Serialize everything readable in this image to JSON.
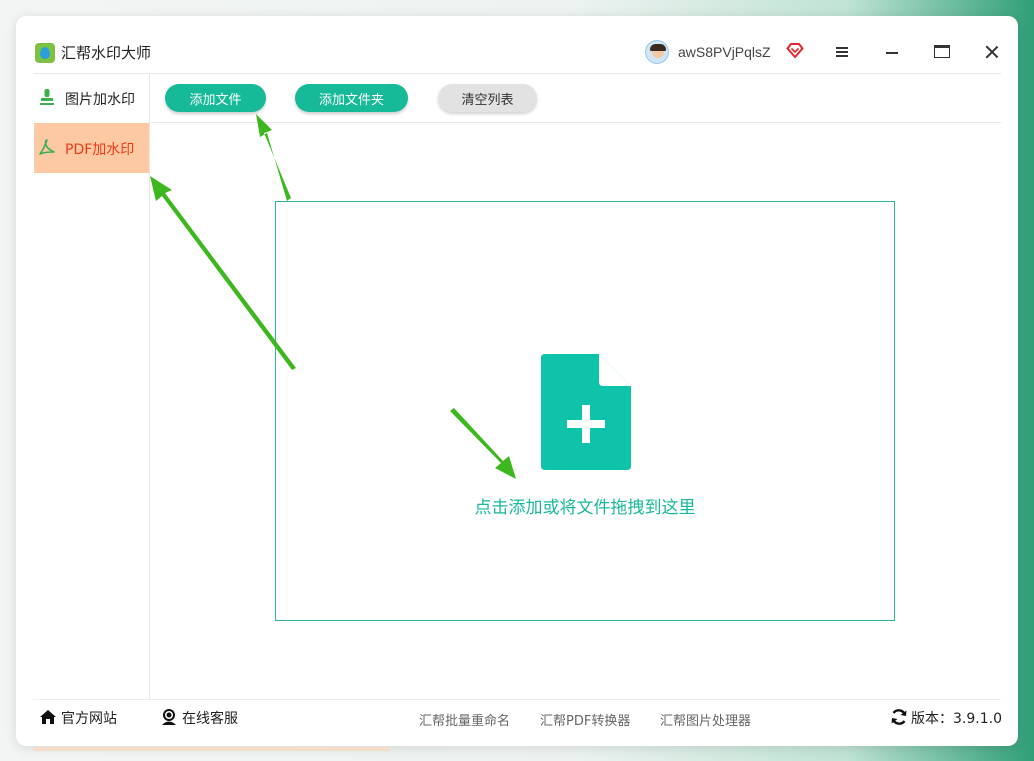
{
  "app": {
    "title": "汇帮水印大师"
  },
  "user": {
    "name": "awS8PVjPqlsZ"
  },
  "window_controls": {
    "menu": "menu-icon",
    "minimize": "minimize-icon",
    "maximize": "maximize-icon",
    "close": "close-icon"
  },
  "sidebar": {
    "items": [
      {
        "label": "图片加水印",
        "icon": "image-stamp-icon",
        "active": false
      },
      {
        "label": "PDF加水印",
        "icon": "pdf-icon",
        "active": true
      }
    ]
  },
  "toolbar": {
    "add_file": "添加文件",
    "add_folder": "添加文件夹",
    "clear_list": "清空列表"
  },
  "dropzone": {
    "hint": "点击添加或将文件拖拽到这里",
    "icon": "file-plus-icon"
  },
  "footer": {
    "website": "官方网站",
    "support": "在线客服",
    "links": [
      "汇帮批量重命名",
      "汇帮PDF转换器",
      "汇帮图片处理器"
    ],
    "version": "版本：3.9.1.0"
  },
  "colors": {
    "accent": "#16b998",
    "active_sidebar_bg": "#fdc9a2",
    "active_sidebar_text": "#f03a17",
    "annotation_arrow": "#3cb81e"
  }
}
